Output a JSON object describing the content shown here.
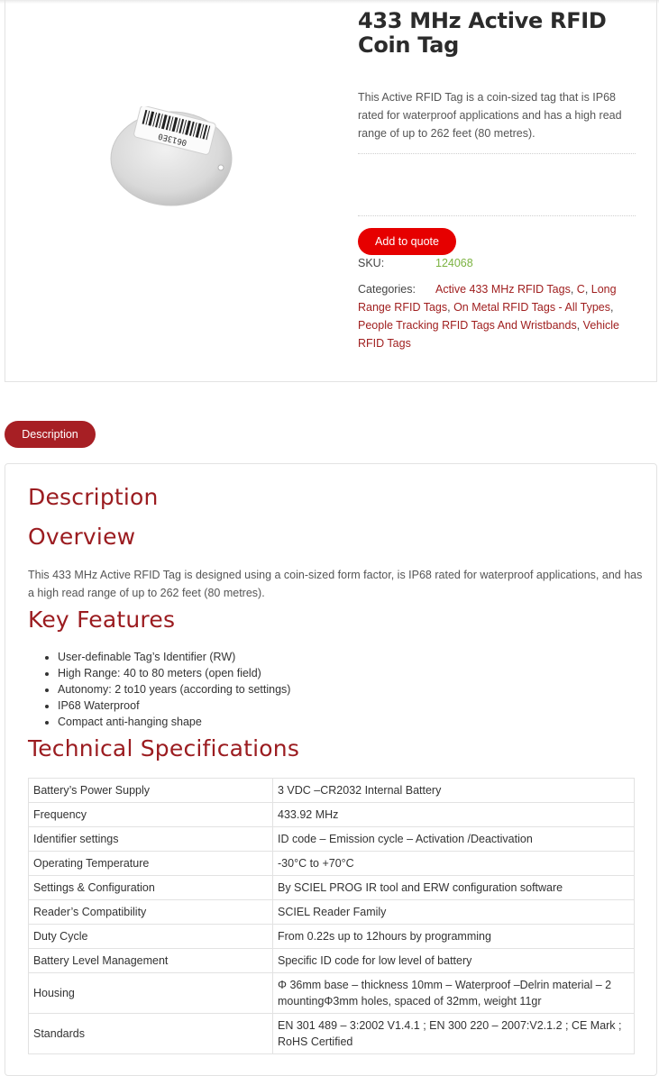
{
  "product": {
    "title": "433 MHz Active RFID Coin Tag",
    "image_tag_text": "0613E0",
    "short_description": "This Active RFID Tag is a coin-sized tag that is IP68 rated for waterproof applications and has a high read range of up to 262 feet (80 metres).",
    "add_to_quote_label": "Add to quote",
    "sku_label": "SKU:",
    "sku_value": "124068",
    "categories_label": "Categories:",
    "categories": [
      {
        "label": "Active 433 MHz RFID Tags",
        "sep": ", "
      },
      {
        "label": "C",
        "sep": ", "
      },
      {
        "label": "Long Range RFID Tags",
        "sep": ", "
      },
      {
        "label": "On Metal RFID Tags - All Types",
        "sep": ", "
      },
      {
        "label": "People Tracking RFID Tags And Wristbands",
        "sep": ", "
      },
      {
        "label": "Vehicle RFID Tags",
        "sep": ""
      }
    ]
  },
  "tabs": {
    "description_label": "Description"
  },
  "description": {
    "heading": "Description",
    "overview_heading": "Overview",
    "overview_text": "This 433 MHz Active RFID Tag is designed using a coin-sized form factor, is IP68 rated for waterproof applications, and has a high read range of up to 262 feet (80 metres).",
    "key_features_heading": "Key Features",
    "features": [
      "User-definable Tag’s Identifier (RW)",
      "High Range: 40 to 80 meters (open field)",
      "Autonomy: 2 to10 years (according to settings)",
      "IP68 Waterproof",
      "Compact anti-hanging shape"
    ],
    "tech_specs_heading": "Technical Specifications",
    "specs": [
      {
        "key": "Battery’s Power Supply",
        "value": "3 VDC –CR2032 Internal Battery"
      },
      {
        "key": "Frequency",
        "value": "433.92 MHz"
      },
      {
        "key": "Identifier settings",
        "value": "ID code – Emission cycle – Activation /Deactivation"
      },
      {
        "key": "Operating Temperature",
        "value": "-30°C to +70°C"
      },
      {
        "key": "Settings & Configuration",
        "value": "By   SCIEL PROG IR tool and ERW configuration software"
      },
      {
        "key": "Reader’s Compatibility",
        "value": "SCIEL Reader Family"
      },
      {
        "key": "Duty Cycle",
        "value": "From 0.22s up to 12hours by programming"
      },
      {
        "key": "Battery Level Management",
        "value": "Specific ID code for low level of battery"
      },
      {
        "key": "Housing",
        "value": "Φ 36mm base – thickness 10mm – Waterproof –Delrin material – 2 mountingΦ3mm holes, spaced of 32mm, weight 11gr"
      },
      {
        "key": "Standards",
        "value": "EN 301 489 – 3:2002 V1.4.1 ; EN 300 220 – 2007:V2.1.2 ; CE Mark ; RoHS Certified"
      }
    ]
  },
  "colors": {
    "accent_red": "#e60000",
    "heading_red": "#9b1c20",
    "tab_red": "#a71f24",
    "sku_green": "#7cb342",
    "link_red": "#a01f1f"
  }
}
